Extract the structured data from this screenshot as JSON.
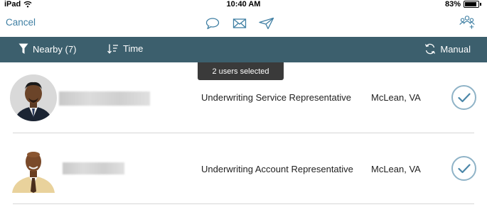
{
  "status_bar": {
    "carrier": "iPad",
    "time": "10:40 AM",
    "battery_label": "83%",
    "battery_level": 0.83,
    "wifi_icon": "wifi-icon"
  },
  "nav": {
    "cancel_label": "Cancel",
    "icons": [
      "chat-bubble-icon",
      "mail-icon",
      "send-icon",
      "add-group-icon"
    ]
  },
  "toolbar": {
    "nearby_label": "Nearby (7)",
    "time_label": "Time",
    "manual_label": "Manual",
    "icons": [
      "filter-icon",
      "sort-icon",
      "refresh-icon"
    ]
  },
  "tooltip": "2 users selected",
  "users": [
    {
      "title": "Underwriting Service Representative",
      "location": "McLean, VA",
      "selected": true
    },
    {
      "title": "Underwriting Account Representative",
      "location": "McLean, VA",
      "selected": true
    }
  ],
  "colors": {
    "accent": "#3f7fa3",
    "toolbar_bg": "#3c5f6d",
    "tooltip_bg": "#3a3a3a",
    "check_ring": "#8fb3c7",
    "check_mark": "#4a86a8"
  }
}
